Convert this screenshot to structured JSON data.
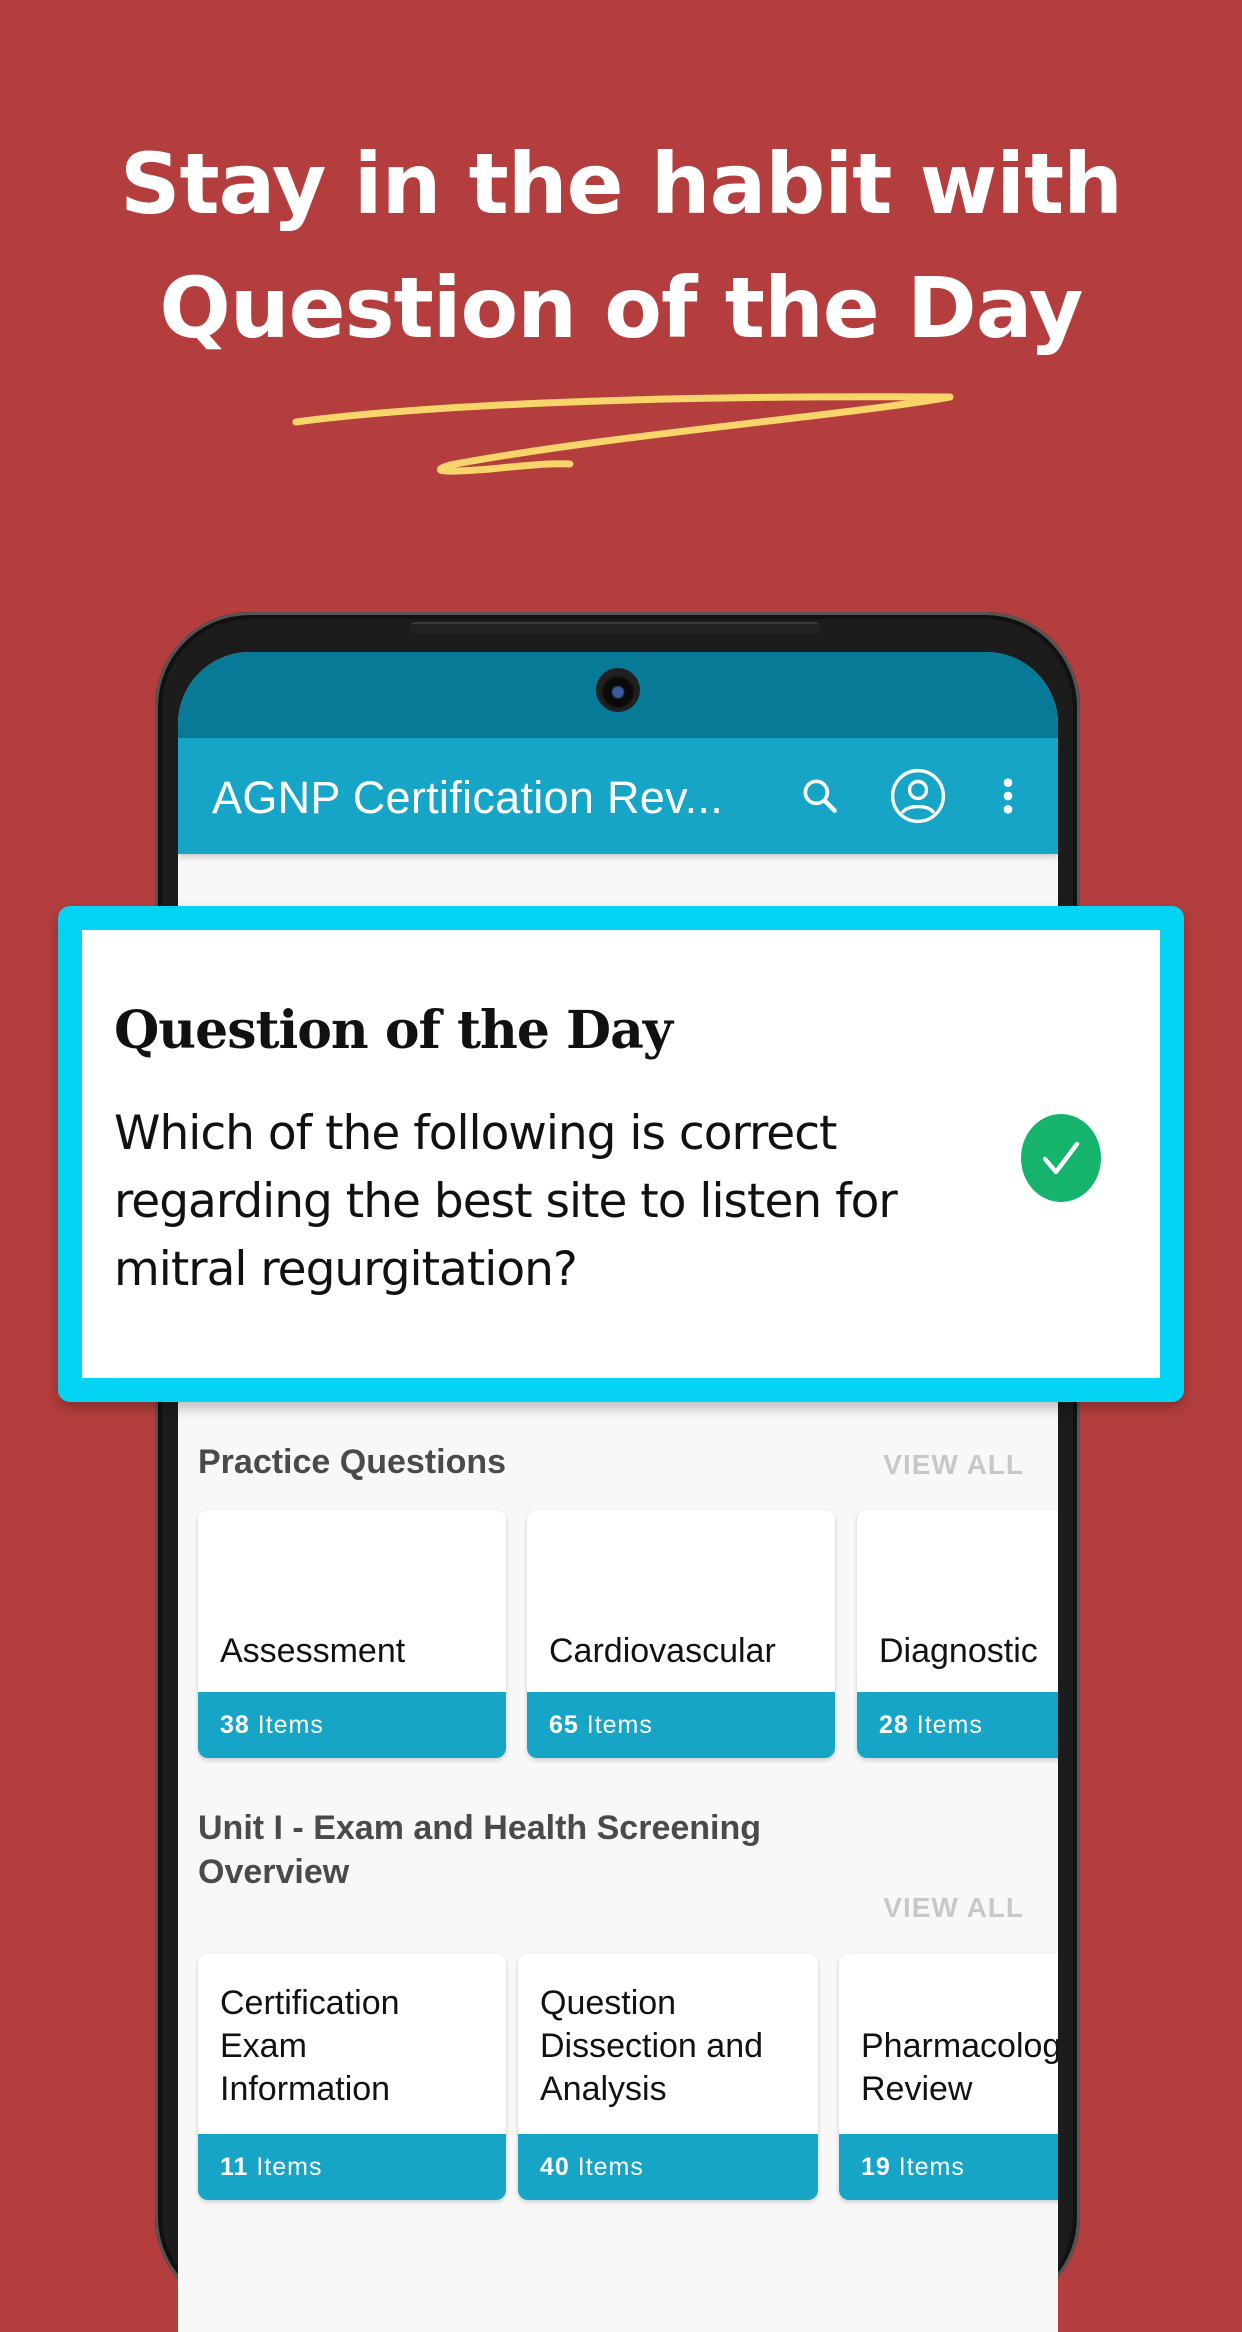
{
  "promo": {
    "headline_line1": "Stay in the habit with",
    "headline_line2": "Question of the Day",
    "accent_color": "#f7d56a",
    "background_color": "#b43e3d"
  },
  "app": {
    "title": "AGNP Certification Rev...",
    "icons": [
      "search-icon",
      "account-icon",
      "more-vert-icon"
    ],
    "primary_color": "#16a5c7",
    "statusbar_color": "#077a98"
  },
  "qotd": {
    "title": "Question of the Day",
    "question": "Which of the following is correct regarding the best site to listen for mitral regurgitation?",
    "status_icon": "check-circle-icon",
    "border_color": "#04d3f3",
    "status_color": "#16b36c"
  },
  "sections": [
    {
      "title": "Practice Questions",
      "view_all": "VIEW ALL",
      "cards": [
        {
          "name": "Assessment",
          "count": "38",
          "unit": "Items"
        },
        {
          "name": "Cardiovascular",
          "count": "65",
          "unit": "Items"
        },
        {
          "name": "Diagnostic",
          "count": "28",
          "unit": "Items"
        }
      ]
    },
    {
      "title": "Unit I - Exam and Health Screening Overview",
      "view_all": "VIEW ALL",
      "cards": [
        {
          "name": "Certification Exam Information",
          "count": "11",
          "unit": "Items"
        },
        {
          "name": "Question Dissection and Analysis",
          "count": "40",
          "unit": "Items"
        },
        {
          "name": "Pharmacology Review",
          "count": "19",
          "unit": "Items"
        }
      ]
    }
  ]
}
